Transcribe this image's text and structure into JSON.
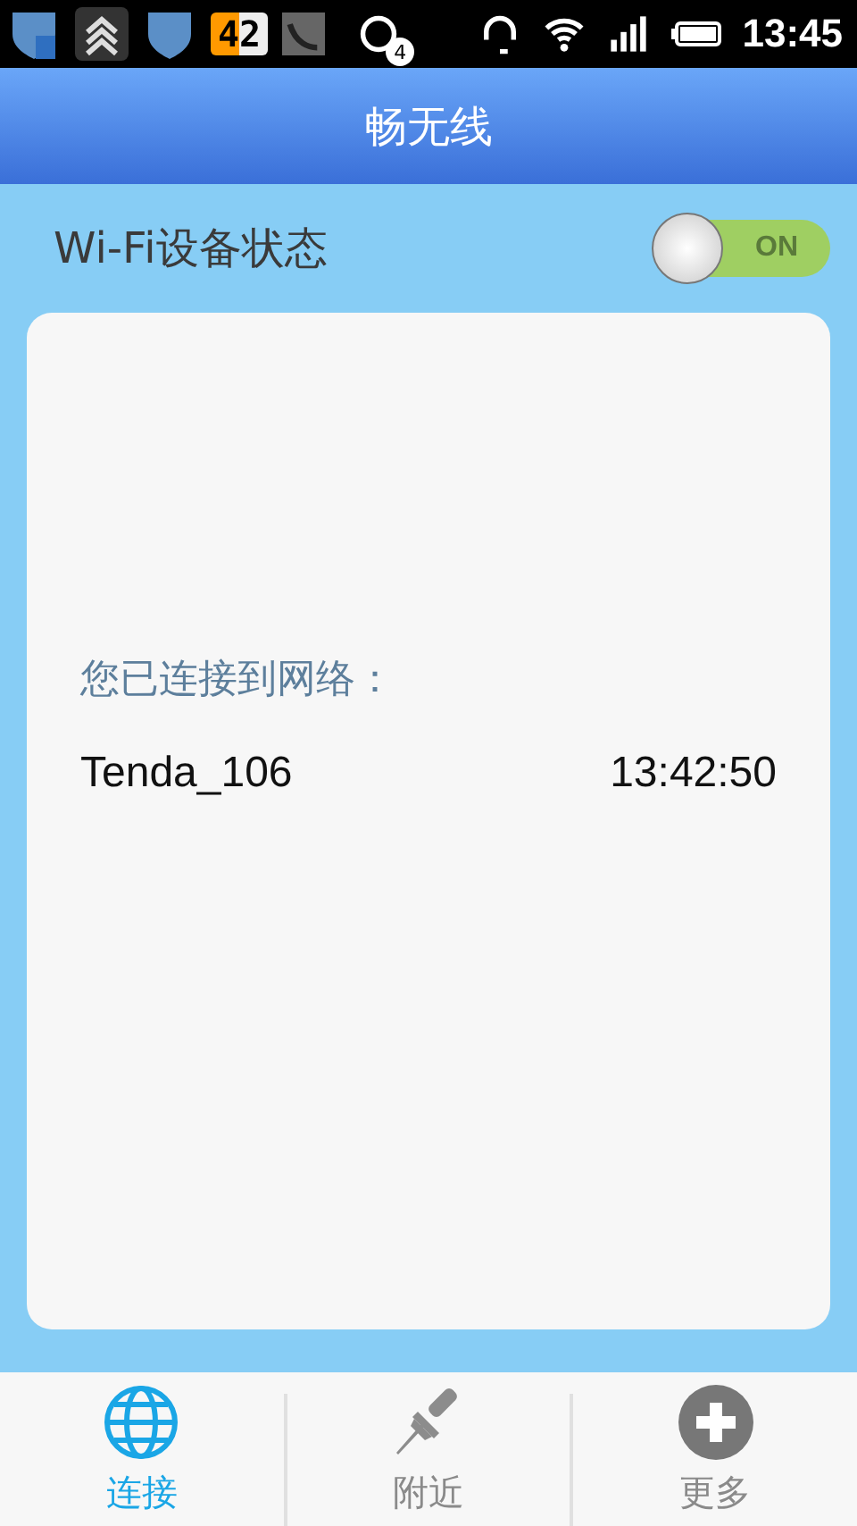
{
  "status_bar": {
    "battery_widget": "42",
    "chat_badge": "4",
    "time": "13:45"
  },
  "header": {
    "title": "畅无线"
  },
  "wifi_status": {
    "label": "Wi-Fi设备状态",
    "toggle": {
      "on": true,
      "label": "ON"
    }
  },
  "connection": {
    "heading": "您已连接到网络：",
    "network": "Tenda_106",
    "time": "13:42:50"
  },
  "nav": [
    {
      "kind": "globe",
      "label": "连接",
      "selected": true
    },
    {
      "kind": "pin",
      "label": "附近",
      "selected": false
    },
    {
      "kind": "plus",
      "label": "更多",
      "selected": false
    }
  ]
}
